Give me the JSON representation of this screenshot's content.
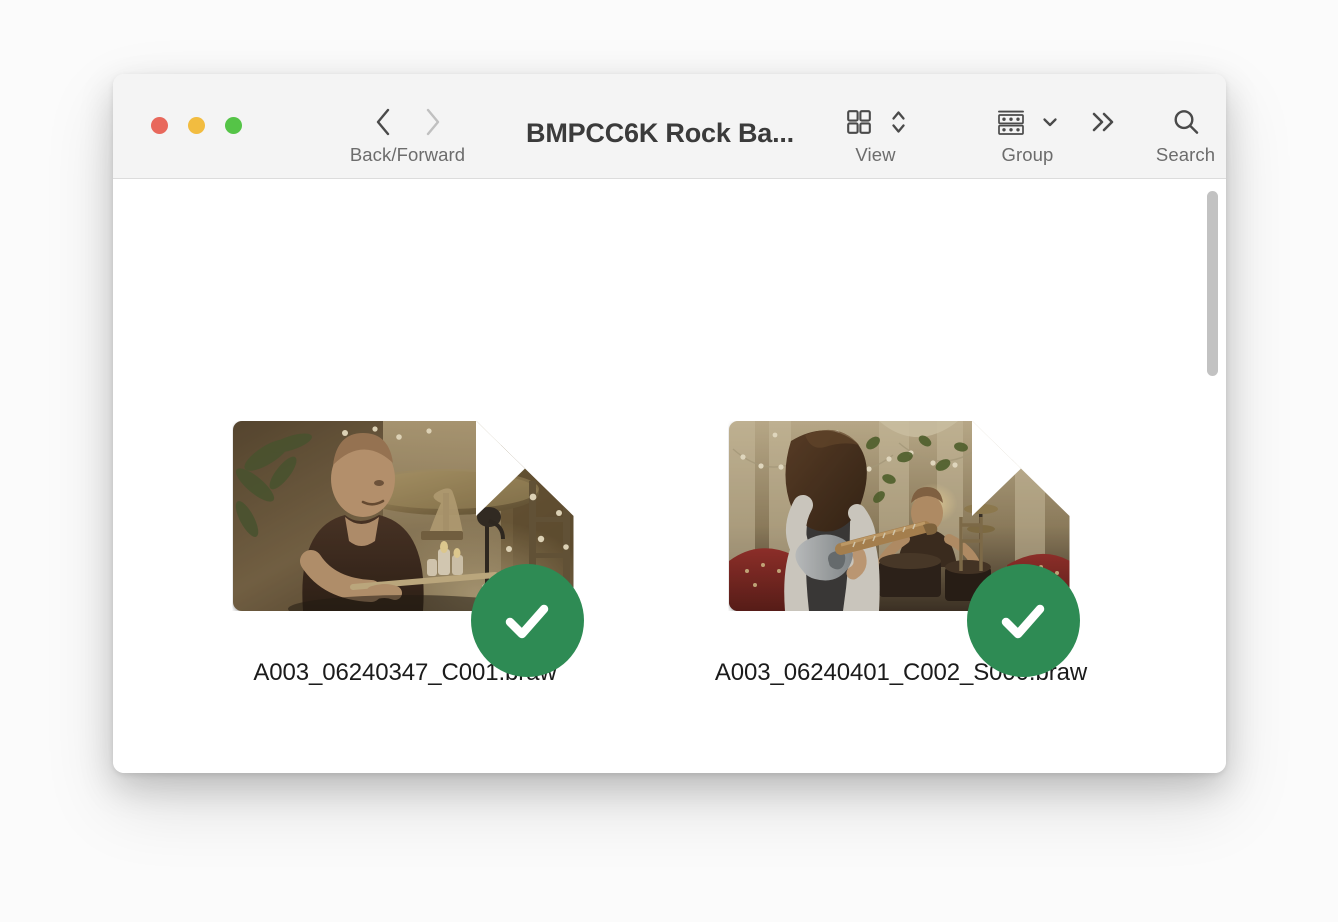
{
  "window": {
    "title": "BMPCC6K Rock Ba...",
    "traffic_lights": [
      {
        "name": "close",
        "color": "#e8685c"
      },
      {
        "name": "minimize",
        "color": "#f2bc40"
      },
      {
        "name": "zoom",
        "color": "#55c447"
      }
    ]
  },
  "toolbar": {
    "back_forward_label": "Back/Forward",
    "view_label": "View",
    "group_label": "Group",
    "search_label": "Search",
    "icons": {
      "back": "chevron-left-icon",
      "forward": "chevron-right-icon",
      "view_grid": "grid-view-icon",
      "view_sort": "chevron-up-down-icon",
      "group_list": "group-list-icon",
      "group_menu": "chevron-down-icon",
      "overflow": "double-chevron-right-icon",
      "search": "search-icon"
    }
  },
  "content": {
    "files": [
      {
        "name": "A003_06240347_C001.braw",
        "badge": "checkmark",
        "badge_color": "#2e8b54",
        "selected": true
      },
      {
        "name": "A003_06240401_C002_S000.braw",
        "badge": "checkmark",
        "badge_color": "#2e8b54",
        "selected": true
      }
    ]
  },
  "scrollbar": {
    "orientation": "vertical",
    "thumb_color": "#c2c2c2"
  }
}
